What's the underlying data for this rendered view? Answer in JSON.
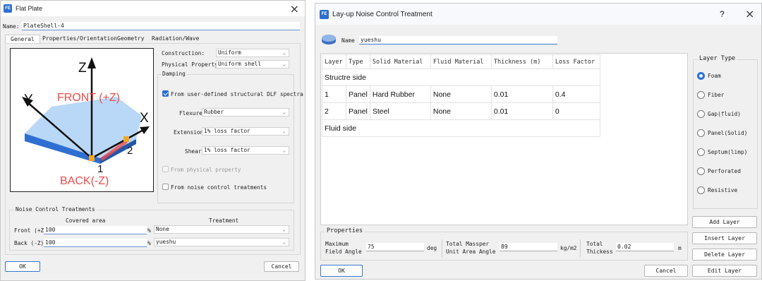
{
  "left_window": {
    "title": "Flat Plate",
    "app_icon": "app-logo-icon",
    "name_label": "Name:",
    "name_value": "PlateShell-4",
    "tabs": [
      "General",
      "Properties/Orientation",
      "Geometry",
      "Radiation/Wave"
    ],
    "diagram": {
      "axis_z": "Z",
      "axis_y": "Y",
      "axis_x": "X",
      "front_label": "FRONT (+Z)",
      "back_label": "BACK(-Z)",
      "node1": "1",
      "node2": "2",
      "plate_color": "#3a7de0",
      "top_color": "#b9d8f7",
      "label_red": "#f04b4b",
      "node_color": "#f5a623"
    },
    "construction_label": "Construction:",
    "construction_value": "Uniform",
    "physical_property_label": "Physical Property:",
    "physical_property_value": "Uniform shell",
    "damping_group": "Damping",
    "dlf_checkbox_label": "From user-defined structural DLF spectra",
    "dlf_checked": true,
    "flexure_label": "Flexure",
    "flexure_value": "Rubber",
    "extension_label": "Extension",
    "extension_value": "1% loss factor",
    "shear_label": "Shear",
    "shear_value": "1% loss factor",
    "from_physical_label": "From physical property",
    "from_noise_label": "From noise control treatments",
    "noise_group": "Noise Control Treatments",
    "covered_area_header": "Covered area",
    "treatment_header": "Treatment",
    "front_label": "Front (+Z)",
    "front_area": "100",
    "front_treatment": "None",
    "back_label": "Back (-Z)",
    "back_area": "100",
    "back_treatment": "yueshu",
    "percent": "%",
    "ok": "OK",
    "cancel": "Cancel"
  },
  "right_window": {
    "title": "Lay-up Noise Control Treatment",
    "help": "?",
    "name_label": "Name",
    "name_value": "yueshu",
    "columns": [
      "Layer",
      "Type",
      "Solid Material",
      "Fluid Material",
      "Thickness (m)",
      "Loss Factor"
    ],
    "structure_side": "Structre side",
    "rows": [
      {
        "layer": "1",
        "type": "Panel",
        "solid": "Hard Rubber",
        "fluid": "None",
        "thickness": "0.01",
        "loss": "0.4"
      },
      {
        "layer": "2",
        "type": "Panel",
        "solid": "Steel",
        "fluid": "None",
        "thickness": "0.01",
        "loss": "0"
      }
    ],
    "fluid_side": "Fluid side",
    "layer_type_group": "Layer Type",
    "layer_types": [
      "Foam",
      "Fiber",
      "Gap(fluid)",
      "Panel(Solid)",
      "Septum(limp)",
      "Perforated",
      "Resistive"
    ],
    "selected_layer_type": "Foam",
    "properties_group": "Properties",
    "max_field_angle_label_1": "Maximum",
    "max_field_angle_label_2": "Field Angle",
    "max_field_angle_value": "75",
    "deg": "deg",
    "total_massper_label_1": "Total Massper",
    "total_massper_label_2": "Unit Area Angle",
    "total_massper_value": "89",
    "kgm2": "kg/m2",
    "total_thickness_label_1": "Total",
    "total_thickness_label_2": "Thickess",
    "total_thickness_value": "0.02",
    "m": "m",
    "add_layer": "Add Layer",
    "insert_layer": "Insert Layer",
    "delete_layer": "Delete Layer",
    "edit_layer": "Edit Layer",
    "ok": "OK",
    "cancel": "Cancel"
  }
}
